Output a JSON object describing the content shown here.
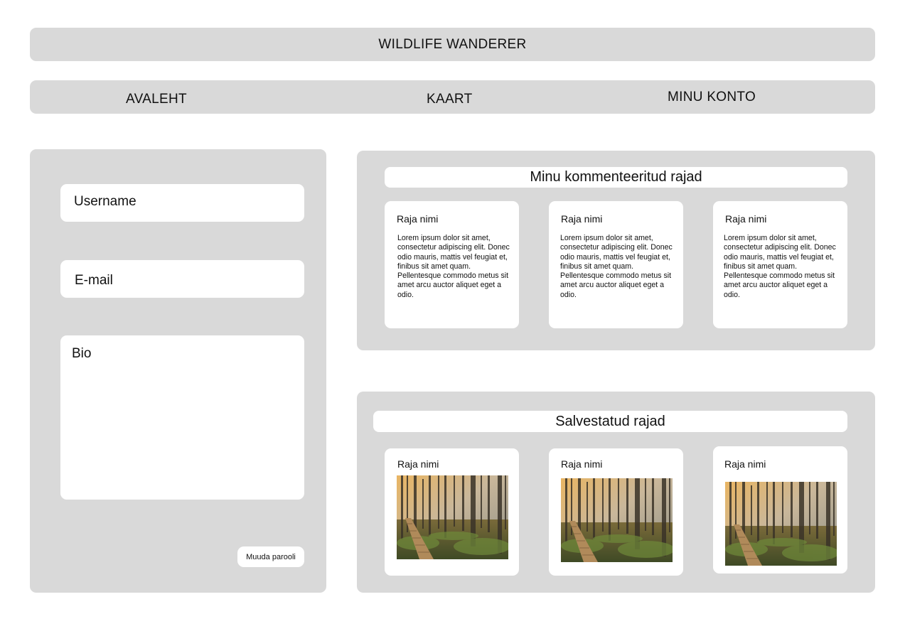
{
  "app": {
    "title": "WILDLIFE WANDERER"
  },
  "nav": {
    "items": [
      {
        "label": "AVALEHT"
      },
      {
        "label": "KAART"
      },
      {
        "label": "MINU KONTO"
      }
    ]
  },
  "profile": {
    "username_placeholder": "Username",
    "email_placeholder": "E-mail",
    "bio_placeholder": "Bio",
    "change_password_label": "Muuda parooli"
  },
  "commented": {
    "title": "Minu kommenteeritud rajad",
    "cards": [
      {
        "title": "Raja nimi",
        "text": "Lorem ipsum dolor sit amet, consectetur adipiscing elit. Donec odio mauris, mattis vel feugiat et, finibus sit amet quam. Pellentesque commodo metus sit amet arcu auctor aliquet eget a odio."
      },
      {
        "title": "Raja nimi",
        "text": "Lorem ipsum dolor sit amet, consectetur adipiscing elit. Donec odio mauris, mattis vel feugiat et, finibus sit amet quam. Pellentesque commodo metus sit amet arcu auctor aliquet eget a odio."
      },
      {
        "title": "Raja nimi",
        "text": "Lorem ipsum dolor sit amet, consectetur adipiscing elit. Donec odio mauris, mattis vel feugiat et, finibus sit amet quam. Pellentesque commodo metus sit amet arcu auctor aliquet eget a odio."
      }
    ]
  },
  "saved": {
    "title": "Salvestatud rajad",
    "cards": [
      {
        "title": "Raja nimi",
        "image": "forest-boardwalk-photo"
      },
      {
        "title": "Raja nimi",
        "image": "forest-boardwalk-photo"
      },
      {
        "title": "Raja nimi",
        "image": "forest-boardwalk-photo"
      }
    ]
  },
  "colors": {
    "panel": "#d9d9d9",
    "surface": "#ffffff",
    "text": "#111111"
  }
}
